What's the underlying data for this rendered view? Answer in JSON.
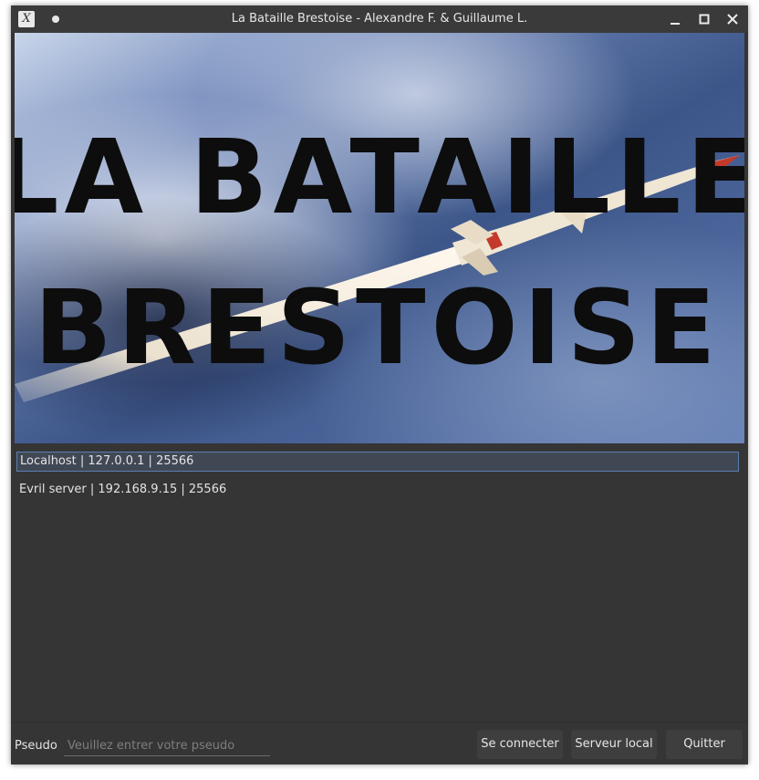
{
  "window": {
    "title": "La Bataille Brestoise - Alexandre F. & Guillaume L.",
    "app_icon_glyph": "X",
    "icons": [
      "app-icon",
      "pin-icon",
      "minimize-icon",
      "maximize-icon",
      "close-icon"
    ],
    "controls": {
      "minimize": "–",
      "maximize": "□",
      "close": "✕"
    }
  },
  "banner": {
    "line1": "LA BATAILLE",
    "line2": "BRESTOISE"
  },
  "servers": [
    {
      "label": "Localhost | 127.0.0.1 | 25566",
      "selected": true
    },
    {
      "label": "Evril server | 192.168.9.15 | 25566",
      "selected": false
    }
  ],
  "footer": {
    "pseudo_label": "Pseudo",
    "pseudo_value": "",
    "pseudo_placeholder": "Veuillez entrer votre pseudo",
    "connect_label": "Se connecter",
    "local_server_label": "Serveur local",
    "quit_label": "Quitter"
  },
  "colors": {
    "window_bg": "#353535",
    "selection_border": "#5a7fb0",
    "selection_bg": "#404854",
    "button_bg": "#3e3e3e"
  }
}
